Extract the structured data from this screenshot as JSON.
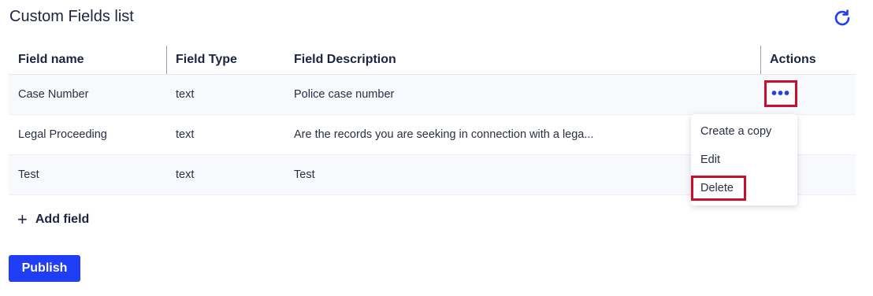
{
  "header": {
    "title": "Custom Fields list",
    "refresh_icon": "refresh-icon",
    "accent_color": "#1f3ef5"
  },
  "table": {
    "columns": [
      "Field name",
      "Field Type",
      "Field Description",
      "Actions"
    ],
    "rows": [
      {
        "name": "Case Number",
        "type": "text",
        "description": "Police case number"
      },
      {
        "name": "Legal Proceeding",
        "type": "text",
        "description": "Are the records you are seeking in connection with a lega..."
      },
      {
        "name": "Test",
        "type": "text",
        "description": "Test"
      }
    ],
    "actions_label": "•••"
  },
  "menu": {
    "items": [
      "Create a copy",
      "Edit",
      "Delete"
    ]
  },
  "footer": {
    "add_field_label": "Add field",
    "publish_label": "Publish"
  },
  "highlight_color": "#c8102e"
}
